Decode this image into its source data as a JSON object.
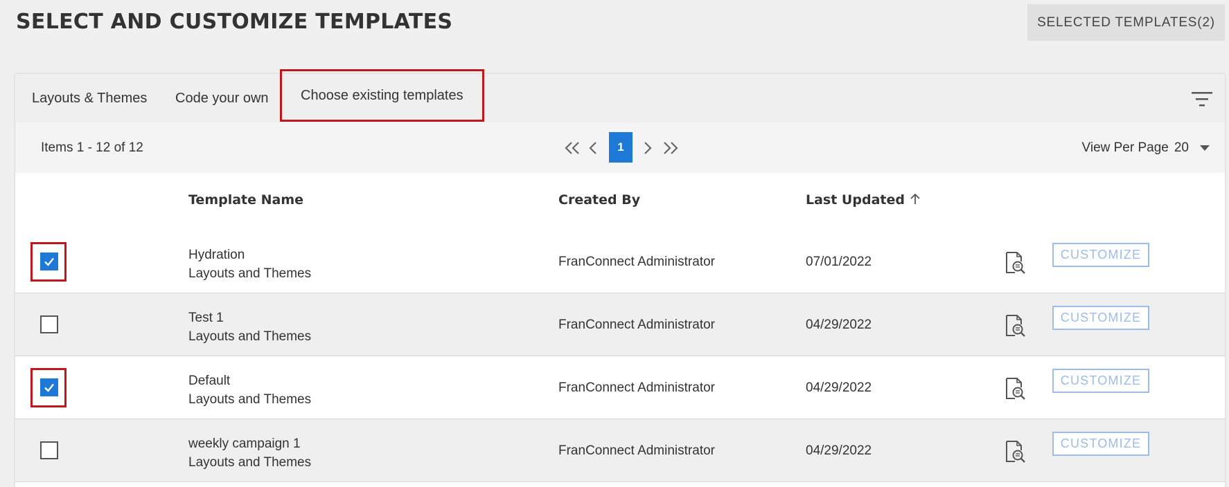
{
  "header": {
    "title": "SELECT AND CUSTOMIZE TEMPLATES",
    "selected_button": "SELECTED TEMPLATES(2)"
  },
  "tabs": [
    {
      "label": "Layouts & Themes",
      "active": false
    },
    {
      "label": "Code your own",
      "active": false
    },
    {
      "label": "Choose existing templates",
      "active": true
    }
  ],
  "pager": {
    "items_label": "Items 1 - 12 of 12",
    "current_page": "1",
    "view_per_page_label": "View Per Page",
    "view_per_page_value": "20"
  },
  "table": {
    "columns": [
      "Template Name",
      "Created By",
      "Last Updated"
    ],
    "sort_icon": "arrow-up-icon",
    "customize_label": "CUSTOMIZE",
    "rows": [
      {
        "name": "Hydration",
        "subtitle": "Layouts and Themes",
        "created_by": "FranConnect Administrator",
        "last_updated": "07/01/2022",
        "checked": true
      },
      {
        "name": "Test 1",
        "subtitle": "Layouts and Themes",
        "created_by": "FranConnect Administrator",
        "last_updated": "04/29/2022",
        "checked": false
      },
      {
        "name": "Default",
        "subtitle": "Layouts and Themes",
        "created_by": "FranConnect Administrator",
        "last_updated": "04/29/2022",
        "checked": true
      },
      {
        "name": "weekly campaign 1",
        "subtitle": "Layouts and Themes",
        "created_by": "FranConnect Administrator",
        "last_updated": "04/29/2022",
        "checked": false
      }
    ]
  },
  "colors": {
    "accent": "#1e78d5",
    "highlight": "#c0161d",
    "customize_border": "#9dbce9"
  }
}
